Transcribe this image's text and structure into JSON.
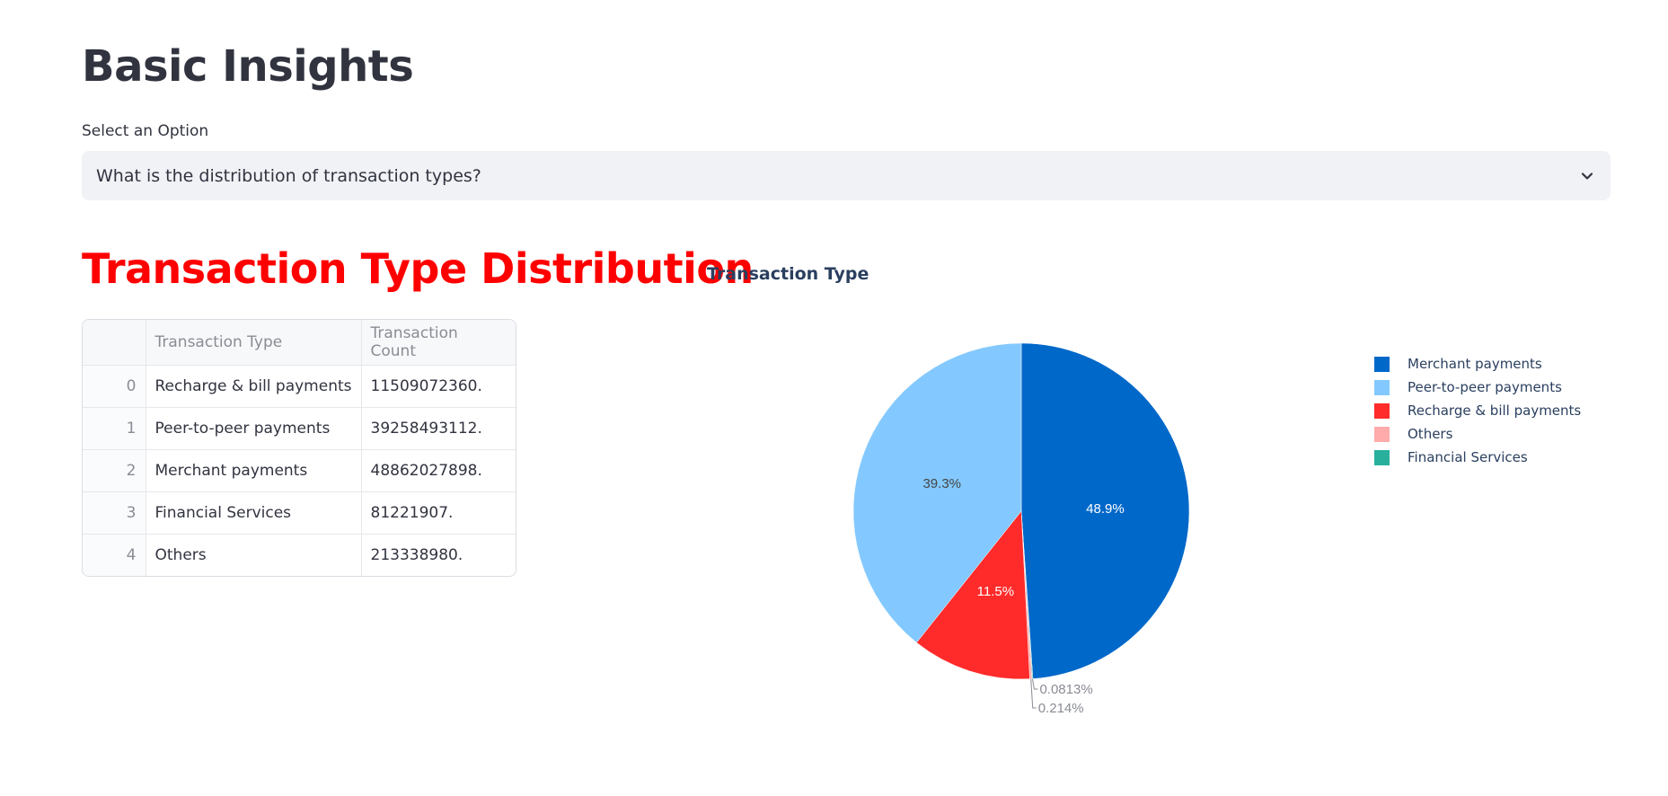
{
  "page": {
    "title": "Basic Insights"
  },
  "select": {
    "label": "Select an Option",
    "value": "What is the distribution of transaction types?",
    "icon": "chevron-down-icon"
  },
  "section": {
    "title": "Transaction Type Distribution",
    "title_color": "#ff0000"
  },
  "table": {
    "columns": [
      "",
      "Transaction Type",
      "Transaction Count"
    ],
    "rows": [
      {
        "index": "0",
        "type": "Recharge & bill payments",
        "count": "11509072360."
      },
      {
        "index": "1",
        "type": "Peer-to-peer payments",
        "count": "39258493112."
      },
      {
        "index": "2",
        "type": "Merchant payments",
        "count": "48862027898."
      },
      {
        "index": "3",
        "type": "Financial Services",
        "count": "81221907."
      },
      {
        "index": "4",
        "type": "Others",
        "count": "213338980."
      }
    ]
  },
  "chart_data": {
    "type": "pie",
    "title": "Transaction Type",
    "legend_position": "top-right",
    "slices": [
      {
        "label": "Merchant payments",
        "value": 48862027898,
        "percent_label": "48.9%",
        "color": "#0068c9",
        "text_color": "#ffffff"
      },
      {
        "label": "Financial Services",
        "value": 81221907,
        "percent_label": "0.0813%",
        "color": "#29b09d",
        "text_color": "#8a8c94"
      },
      {
        "label": "Others",
        "value": 213338980,
        "percent_label": "0.214%",
        "color": "#ffabab",
        "text_color": "#8a8c94"
      },
      {
        "label": "Recharge & bill payments",
        "value": 11509072360,
        "percent_label": "11.5%",
        "color": "#ff2b2b",
        "text_color": "#ffffff"
      },
      {
        "label": "Peer-to-peer payments",
        "value": 39258493112,
        "percent_label": "39.3%",
        "color": "#83c9ff",
        "text_color": "#444444"
      }
    ],
    "legend": [
      "Merchant payments",
      "Peer-to-peer payments",
      "Recharge & bill payments",
      "Others",
      "Financial Services"
    ]
  }
}
